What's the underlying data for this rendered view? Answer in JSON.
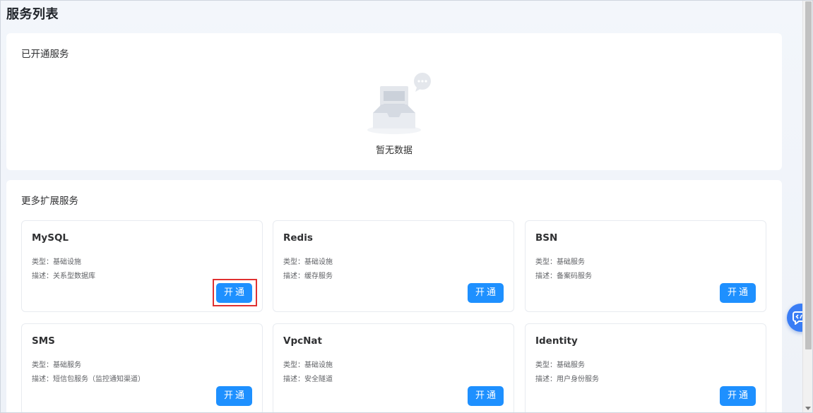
{
  "page": {
    "title": "服务列表"
  },
  "opened_section": {
    "title": "已开通服务",
    "empty_text": "暂无数据"
  },
  "more_section": {
    "title": "更多扩展服务",
    "services": [
      {
        "name": "MySQL",
        "type": "类型：基础设施",
        "desc": "描述：关系型数据库",
        "button": "开通"
      },
      {
        "name": "Redis",
        "type": "类型：基础设施",
        "desc": "描述：缓存服务",
        "button": "开通"
      },
      {
        "name": "BSN",
        "type": "类型：基础服务",
        "desc": "描述：备案码服务",
        "button": "开通"
      },
      {
        "name": "SMS",
        "type": "类型：基础服务",
        "desc": "描述：短信包服务（监控通知渠道）",
        "button": "开通"
      },
      {
        "name": "VpcNat",
        "type": "类型：基础设施",
        "desc": "描述：安全隧道",
        "button": "开通"
      },
      {
        "name": "Identity",
        "type": "类型：基础服务",
        "desc": "描述：用户身份服务",
        "button": "开通"
      }
    ]
  },
  "icons": {
    "empty": "empty-inbox-icon",
    "chat": "chat-bubble-icon",
    "widget": "code-assistant-icon"
  },
  "colors": {
    "primary": "#1e90ff",
    "highlight": "#e03131",
    "background": "#f3f6fb"
  }
}
